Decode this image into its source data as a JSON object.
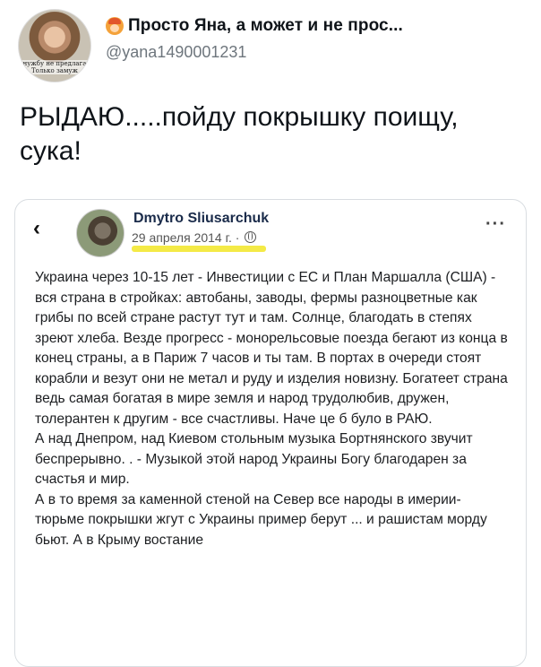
{
  "tweet": {
    "avatar_caption": "нужбу не предлага Только замуж",
    "display_name": "Просто Яна, а может и не прос...",
    "handle": "@yana1490001231",
    "text": "РЫДАЮ.....пойду покрышку поищу, сука!"
  },
  "embedded_post": {
    "back_icon": "‹",
    "author": "Dmytro Sliusarchuk",
    "date": "29 апреля 2014 г. ·",
    "more_icon": "···",
    "highlight_color": "#f4ea46",
    "paragraphs": [
      "Украина через 10-15 лет - Инвестиции с ЕС и План Маршалла (США) - вся страна в стройках: автобаны, заводы, фермы разноцветные как грибы по всей стране растут тут и там. Солнце, благодать в степях зреют хлеба. Везде прогресс - монорельсовые поезда бегают из конца в конец страны, а в Париж 7 часов и ты там. В портах в очереди стоят корабли и везут они не метал и руду и изделия новизну. Богатеет страна ведь самая богатая в мире земля и народ трудолюбив, дружен, толерантен к другим - все счастливы. Наче це б було в РАЮ.",
      "А над Днепром, над Киевом стольным музыка Бортнянского звучит беспрерывно. . - Музыкой этой народ Украины Богу благодарен за счастья и мир.",
      "А в то время за каменной стеной на Север все народы в имерии-тюрьме покрышки жгут с Украины пример берут ... и рашистам морду бьют. А в Крыму востание"
    ]
  }
}
